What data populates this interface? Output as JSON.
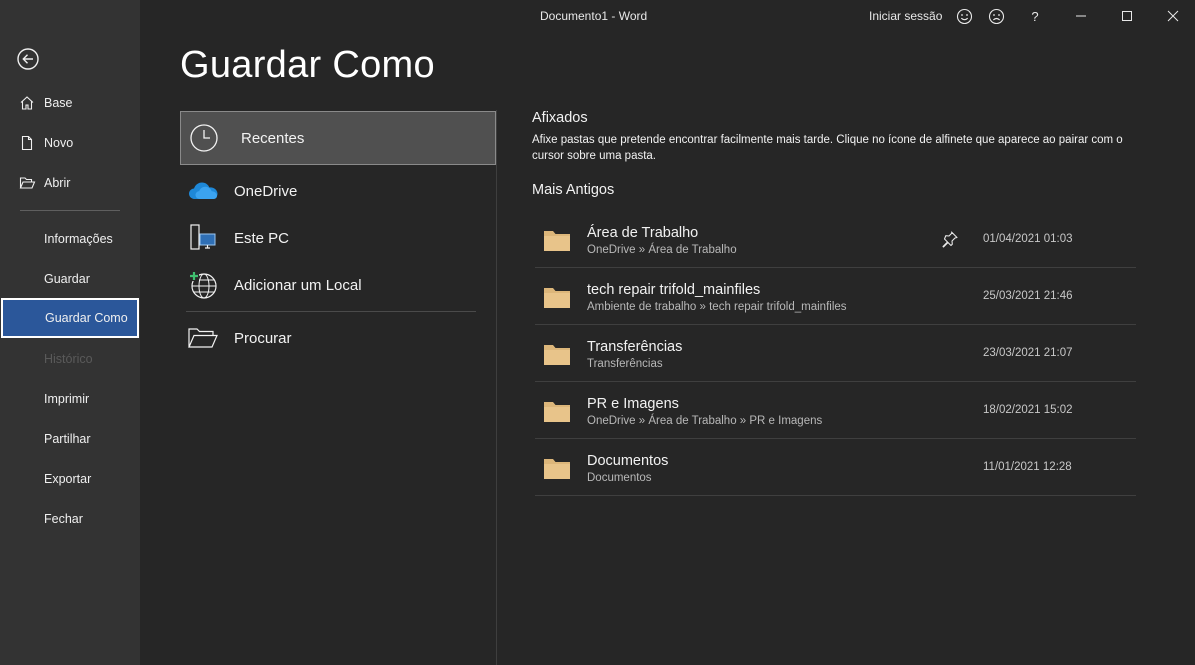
{
  "titlebar": {
    "doc_title": "Documento1  -  Word",
    "signin": "Iniciar sessão",
    "help": "?"
  },
  "nav": {
    "items": [
      {
        "label": "Base",
        "icon": "home-icon"
      },
      {
        "label": "Novo",
        "icon": "new-doc-icon"
      },
      {
        "label": "Abrir",
        "icon": "open-folder-icon"
      },
      {
        "label": "Informações"
      },
      {
        "label": "Guardar"
      },
      {
        "label": "Guardar Como",
        "active": true
      },
      {
        "label": "Histórico",
        "disabled": true
      },
      {
        "label": "Imprimir"
      },
      {
        "label": "Partilhar"
      },
      {
        "label": "Exportar"
      },
      {
        "label": "Fechar"
      }
    ]
  },
  "page": {
    "title": "Guardar Como"
  },
  "locations": {
    "items": [
      {
        "label": "Recentes",
        "icon": "clock-icon",
        "selected": true
      },
      {
        "label": "OneDrive",
        "icon": "onedrive-icon"
      },
      {
        "label": "Este PC",
        "icon": "this-pc-icon"
      },
      {
        "label": "Adicionar um Local",
        "icon": "add-place-icon"
      },
      {
        "label": "Procurar",
        "icon": "browse-folder-icon"
      }
    ]
  },
  "pinned": {
    "heading": "Afixados",
    "description": "Afixe pastas que pretende encontrar facilmente mais tarde. Clique no ícone de alfinete que aparece ao pairar com o cursor sobre uma pasta."
  },
  "older": {
    "heading": "Mais Antigos",
    "folders": [
      {
        "name": "Área de Trabalho",
        "path": "OneDrive » Área de Trabalho",
        "date": "01/04/2021 01:03",
        "pin_visible": true
      },
      {
        "name": "tech repair trifold_mainfiles",
        "path": "Ambiente de trabalho » tech repair trifold_mainfiles",
        "date": "25/03/2021 21:46"
      },
      {
        "name": "Transferências",
        "path": "Transferências",
        "date": "23/03/2021 21:07"
      },
      {
        "name": "PR e Imagens",
        "path": "OneDrive » Área de Trabalho » PR e Imagens",
        "date": "18/02/2021 15:02"
      },
      {
        "name": "Documentos",
        "path": "Documentos",
        "date": "11/01/2021 12:28"
      }
    ]
  },
  "colors": {
    "nav_bg": "#333333",
    "main_bg": "#262626",
    "active_nav": "#2b579a",
    "folder": "#dcb67a"
  }
}
